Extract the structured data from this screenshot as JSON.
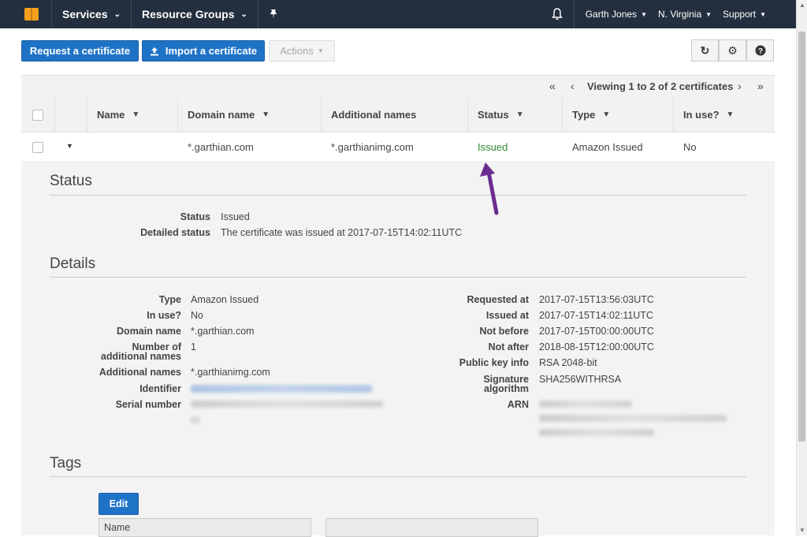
{
  "nav": {
    "services": "Services",
    "resource_groups": "Resource Groups",
    "user": "Garth Jones",
    "region": "N. Virginia",
    "support": "Support"
  },
  "toolbar": {
    "request_label": "Request a certificate",
    "import_label": "Import a certificate",
    "actions_label": "Actions"
  },
  "pager": {
    "text": "Viewing 1 to 2 of 2 certificates"
  },
  "table": {
    "headers": [
      "Name",
      "Domain name",
      "Additional names",
      "Status",
      "Type",
      "In use?"
    ],
    "row": {
      "name": "",
      "domain": "*.garthian.com",
      "additional": "*.garthianimg.com",
      "status": "Issued",
      "type": "Amazon Issued",
      "in_use": "No"
    }
  },
  "status_section": {
    "title": "Status",
    "status_label": "Status",
    "status_value": "Issued",
    "detailed_label": "Detailed status",
    "detailed_value": "The certificate was issued at 2017-07-15T14:02:11UTC"
  },
  "details_section": {
    "title": "Details",
    "left": {
      "type_label": "Type",
      "type_value": "Amazon Issued",
      "inuse_label": "In use?",
      "inuse_value": "No",
      "domain_label": "Domain name",
      "domain_value": "*.garthian.com",
      "num_label_1": "Number of",
      "num_label_2": "additional names",
      "num_value": "1",
      "addl_label": "Additional names",
      "addl_value": "*.garthianimg.com",
      "identifier_label": "Identifier",
      "serial_label": "Serial number"
    },
    "right": {
      "requested_label": "Requested at",
      "requested_value": "2017-07-15T13:56:03UTC",
      "issued_label": "Issued at",
      "issued_value": "2017-07-15T14:02:11UTC",
      "notbefore_label": "Not before",
      "notbefore_value": "2017-07-15T00:00:00UTC",
      "notafter_label": "Not after",
      "notafter_value": "2018-08-15T12:00:00UTC",
      "pubkey_label": "Public key info",
      "pubkey_value": "RSA 2048-bit",
      "sig_label_1": "Signature",
      "sig_label_2": "algorithm",
      "sig_value": "SHA256WITHRSA",
      "arn_label": "ARN"
    }
  },
  "tags_section": {
    "title": "Tags",
    "edit_label": "Edit",
    "name_column": "Name"
  },
  "colors": {
    "topnav": "#232f3e",
    "primary": "#1f73c7",
    "status_issued": "#2e8b2e",
    "annotation_arrow": "#6a2c8f"
  }
}
